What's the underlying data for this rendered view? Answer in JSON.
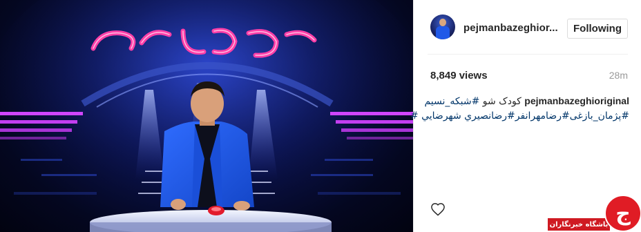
{
  "media": {
    "description_icon": "video-frame",
    "sign_text": "کودک شو"
  },
  "post": {
    "username": "pejmanbazeghior...",
    "follow_label": "Following",
    "views": "8,849 views",
    "time": "28m",
    "caption": {
      "username": "pejmanbazeghioriginal",
      "line1_plain": "کودک شو ",
      "line1_tag": "#شبکه_نسیم",
      "line2": "#پژمان_بازغی#رضامهرانفر#رضانصیري شهرضایي #"
    },
    "like_icon": "heart-outline-icon"
  },
  "watermark": {
    "glyph": "ج",
    "label": "باشگاه خبرنگاران"
  },
  "colors": {
    "link": "#003569",
    "neon_pink": "#ff3fa8",
    "jacket_blue": "#1f5ae6",
    "watermark_red": "#e01c25"
  }
}
